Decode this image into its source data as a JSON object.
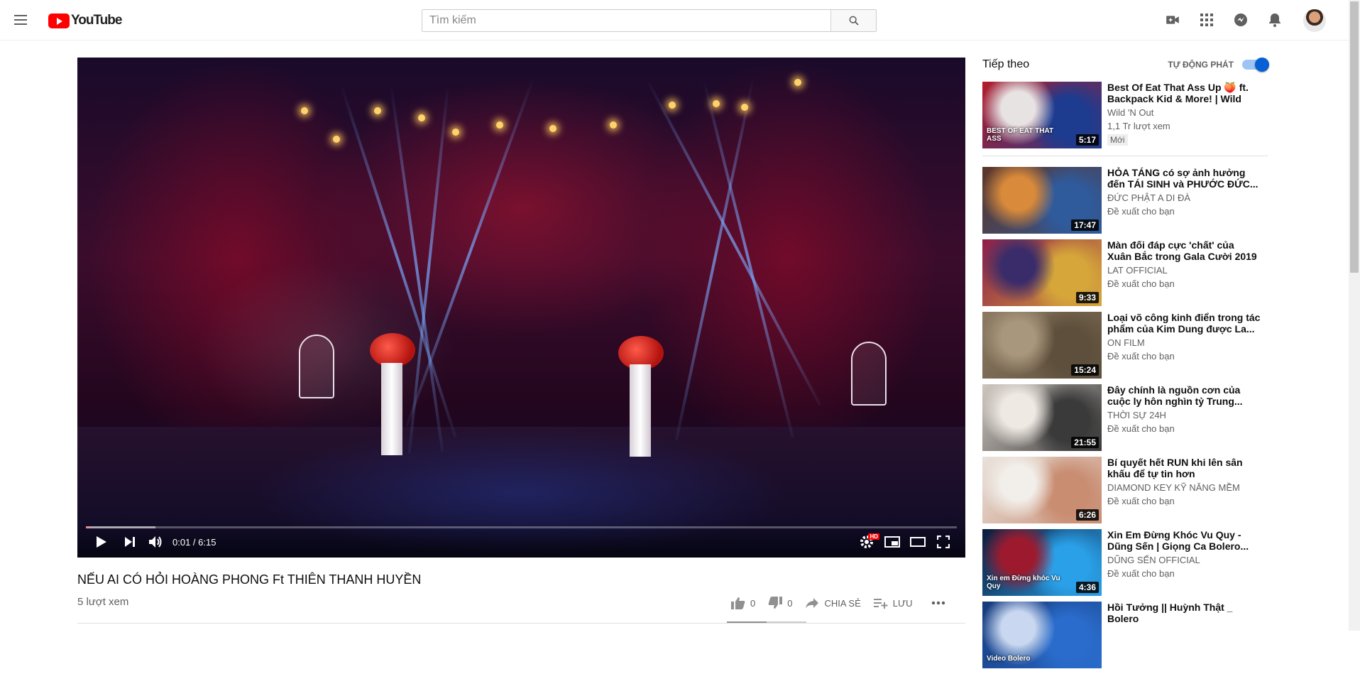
{
  "header": {
    "logo_text": "YouTube",
    "search_placeholder": "Tìm kiếm",
    "icons": [
      "menu-icon",
      "search-icon",
      "video-camera-icon",
      "apps-icon",
      "chat-icon",
      "bell-icon"
    ]
  },
  "player": {
    "time": "0:01 / 6:15",
    "progress": 0.003,
    "buffered": 0.08,
    "hd_badge": "HD"
  },
  "video": {
    "title": "NẾU AI CÓ HỎI HOÀNG PHONG Ft THIÊN THANH HUYỀN",
    "views": "5 lượt xem",
    "likes": "0",
    "dislikes": "0",
    "share_label": "CHIA SẺ",
    "save_label": "LƯU"
  },
  "sidebar": {
    "up_next": "Tiếp theo",
    "autoplay_label": "TỰ ĐỘNG PHÁT",
    "autoplay_on": true,
    "videos": [
      {
        "title": "Best Of Eat That Ass Up 🍑 ft. Backpack Kid & More! | Wild 'N...",
        "channel": "Wild 'N Out",
        "sub": "1,1 Tr lượt xem",
        "badge": "Mới",
        "duration": "5:17",
        "thumb_colors": [
          "#b31c2a",
          "#1d3b8f",
          "#e8e3e3"
        ],
        "thumb_text": "BEST OF EAT THAT ASS"
      },
      {
        "title": "HỎA TÁNG có sợ ảnh hưởng đến TÁI SINH và PHƯỚC ĐỨC...",
        "channel": "ĐỨC PHẬT A DI ĐÀ",
        "sub": "Đề xuất cho bạn",
        "badge": "",
        "duration": "17:47",
        "thumb_colors": [
          "#5c3426",
          "#2f5a9c",
          "#d98a3a"
        ],
        "thumb_text": ""
      },
      {
        "title": "Màn đối đáp cực 'chất' của Xuân Bắc trong Gala Cười 2019",
        "channel": "LAT OFFICIAL",
        "sub": "Đề xuất cho bạn",
        "badge": "",
        "duration": "9:33",
        "thumb_colors": [
          "#8e1d4a",
          "#d6a63a",
          "#3a2c6a"
        ],
        "thumb_text": ""
      },
      {
        "title": "Loại võ công kinh điển trong tác phẩm của Kim Dung được La...",
        "channel": "ON FILM",
        "sub": "Đề xuất cho bạn",
        "badge": "",
        "duration": "15:24",
        "thumb_colors": [
          "#8c7a62",
          "#5e4f3c",
          "#a8977c"
        ],
        "thumb_text": ""
      },
      {
        "title": "Đây chính là nguồn cơn của cuộc ly hôn nghìn tỷ Trung...",
        "channel": "THỜI SỰ 24H",
        "sub": "Đề xuất cho bạn",
        "badge": "",
        "duration": "21:55",
        "thumb_colors": [
          "#cfc7bf",
          "#3a3a3a",
          "#efe9e3"
        ],
        "thumb_text": ""
      },
      {
        "title": "Bí quyết hết RUN khi lên sân khấu để tự tin hơn",
        "channel": "DIAMOND KEY KỸ NĂNG MỀM",
        "sub": "Đề xuất cho bạn",
        "badge": "",
        "duration": "6:26",
        "thumb_colors": [
          "#e8e2dc",
          "#c98d72",
          "#f2efea"
        ],
        "thumb_text": ""
      },
      {
        "title": "Xin Em Đừng Khóc Vu Quy - Dũng Sến | Giọng Ca Bolero...",
        "channel": "DŨNG SẾN OFFICIAL",
        "sub": "Đề xuất cho bạn",
        "badge": "",
        "duration": "4:36",
        "thumb_colors": [
          "#0c1a3a",
          "#2aa0e8",
          "#9d1a2e"
        ],
        "thumb_text": "Xin em Đừng khóc Vu Quy"
      },
      {
        "title": "Hồi Tưởng || Huỳnh Thật _ Bolero",
        "channel": "",
        "sub": "",
        "badge": "",
        "duration": "",
        "thumb_colors": [
          "#163a7a",
          "#2a6ccc",
          "#c9d8f0"
        ],
        "thumb_text": "Video Bolero"
      }
    ]
  }
}
